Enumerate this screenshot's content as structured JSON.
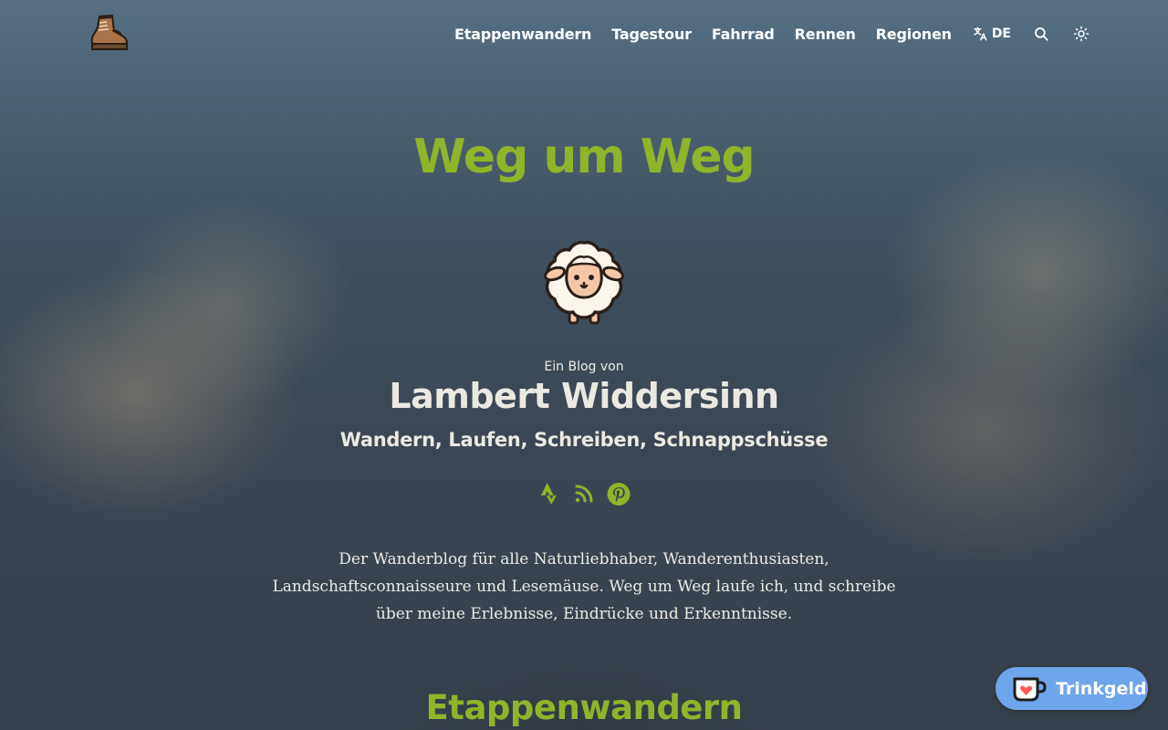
{
  "header": {
    "nav": [
      {
        "label": "Etappenwandern"
      },
      {
        "label": "Tagestour"
      },
      {
        "label": "Fahrrad"
      },
      {
        "label": "Rennen"
      },
      {
        "label": "Regionen"
      }
    ],
    "language": "DE",
    "icons": {
      "logo": "hiking-boot-icon",
      "language": "translate-icon",
      "search": "search-icon",
      "theme": "sun-icon"
    }
  },
  "hero": {
    "title": "Weg um Weg",
    "avatar_icon": "sheep-icon",
    "byline": "Ein Blog von",
    "author": "Lambert Widdersinn",
    "tagline": "Wandern, Laufen, Schreiben, Schnappschüsse",
    "social_icons": [
      "strava-icon",
      "rss-icon",
      "pinterest-icon"
    ],
    "intro": "Der Wanderblog für alle Naturliebhaber, Wanderenthusiasten, Landschaftsconnaisseure und Lesemäuse. Weg um Weg laufe ich, und schreibe über meine Erlebnisse, Eindrücke und Erkenntnisse."
  },
  "section": {
    "title": "Etappenwandern"
  },
  "tip_button": {
    "label": "Trinkgeld",
    "icon": "kofi-cup-icon"
  },
  "colors": {
    "accent": "#90b42a",
    "tip_button": "#6da6eb",
    "text": "#ebe9e1"
  }
}
